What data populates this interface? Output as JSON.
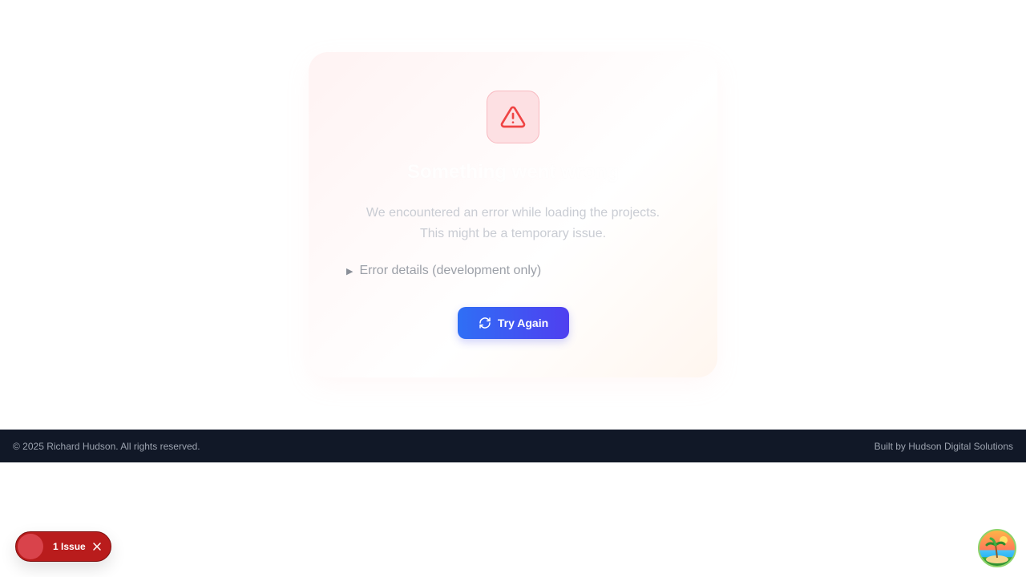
{
  "error_card": {
    "title": "Something went wrong",
    "message_line1": "We encountered an error while loading the projects.",
    "message_line2": "This might be a temporary issue.",
    "details_label": "Error details (development only)",
    "retry_label": "Try Again",
    "icon": "warning-triangle-icon"
  },
  "footer": {
    "copyright": "© 2025 Richard Hudson. All rights reserved.",
    "built_by": "Built by Hudson Digital Solutions"
  },
  "dev_overlay": {
    "issues_label": "1 Issue"
  },
  "colors": {
    "accent_start": "#2f6ff5",
    "accent_end": "#4f3ff0",
    "error": "#ef4444",
    "footer_bg": "#111827"
  }
}
